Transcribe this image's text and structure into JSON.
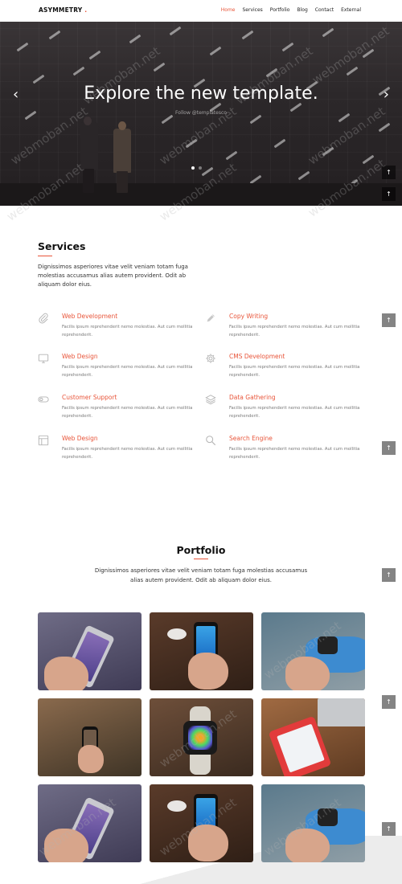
{
  "header": {
    "logo": "ASYMMETRY",
    "logo_dot": ".",
    "nav": [
      "Home",
      "Services",
      "Portfolio",
      "Blog",
      "Contact",
      "External"
    ],
    "active": "Home"
  },
  "hero": {
    "title": "Explore the new template.",
    "subtitle": "Follow @templatesco",
    "prev": "‹",
    "next": "›",
    "slides": 3,
    "active_slide": 1
  },
  "side_buttons": [
    "↑",
    "↑",
    "↑",
    "↑",
    "↑",
    "↑",
    "↑"
  ],
  "watermark": "webmoban.net",
  "services": {
    "title": "Services",
    "lead": "Dignissimos asperiores vitae velit veniam totam fuga molestias accusamus alias autem provident. Odit ab aliquam dolor eius.",
    "items": [
      {
        "icon": "paperclip-icon",
        "name": "Web Development",
        "desc": "Facilis ipsum reprehenderit nemo molestias. Aut cum mollitia reprehenderit."
      },
      {
        "icon": "pen-icon",
        "name": "Copy Writing",
        "desc": "Facilis ipsum reprehenderit nemo molestias. Aut cum mollitia reprehenderit."
      },
      {
        "icon": "monitor-icon",
        "name": "Web Design",
        "desc": "Facilis ipsum reprehenderit nemo molestias. Aut cum mollitia reprehenderit."
      },
      {
        "icon": "gear-icon",
        "name": "CMS Development",
        "desc": "Facilis ipsum reprehenderit nemo molestias. Aut cum mollitia reprehenderit."
      },
      {
        "icon": "toggle-icon",
        "name": "Customer Support",
        "desc": "Facilis ipsum reprehenderit nemo molestias. Aut cum mollitia reprehenderit."
      },
      {
        "icon": "layers-icon",
        "name": "Data Gathering",
        "desc": "Facilis ipsum reprehenderit nemo molestias. Aut cum mollitia reprehenderit."
      },
      {
        "icon": "layout-icon",
        "name": "Web Design",
        "desc": "Facilis ipsum reprehenderit nemo molestias. Aut cum mollitia reprehenderit."
      },
      {
        "icon": "search-icon",
        "name": "Search Engine",
        "desc": "Facilis ipsum reprehenderit nemo molestias. Aut cum mollitia reprehenderit."
      }
    ]
  },
  "portfolio": {
    "title": "Portfolio",
    "lead": "Dignissimos asperiores vitae velit veniam totam fuga molestias accusamus alias autem provident. Odit ab aliquam dolor eius."
  },
  "colors": {
    "accent": "#e8553a",
    "hero_dark": "#2c282a",
    "text": "#333333"
  }
}
